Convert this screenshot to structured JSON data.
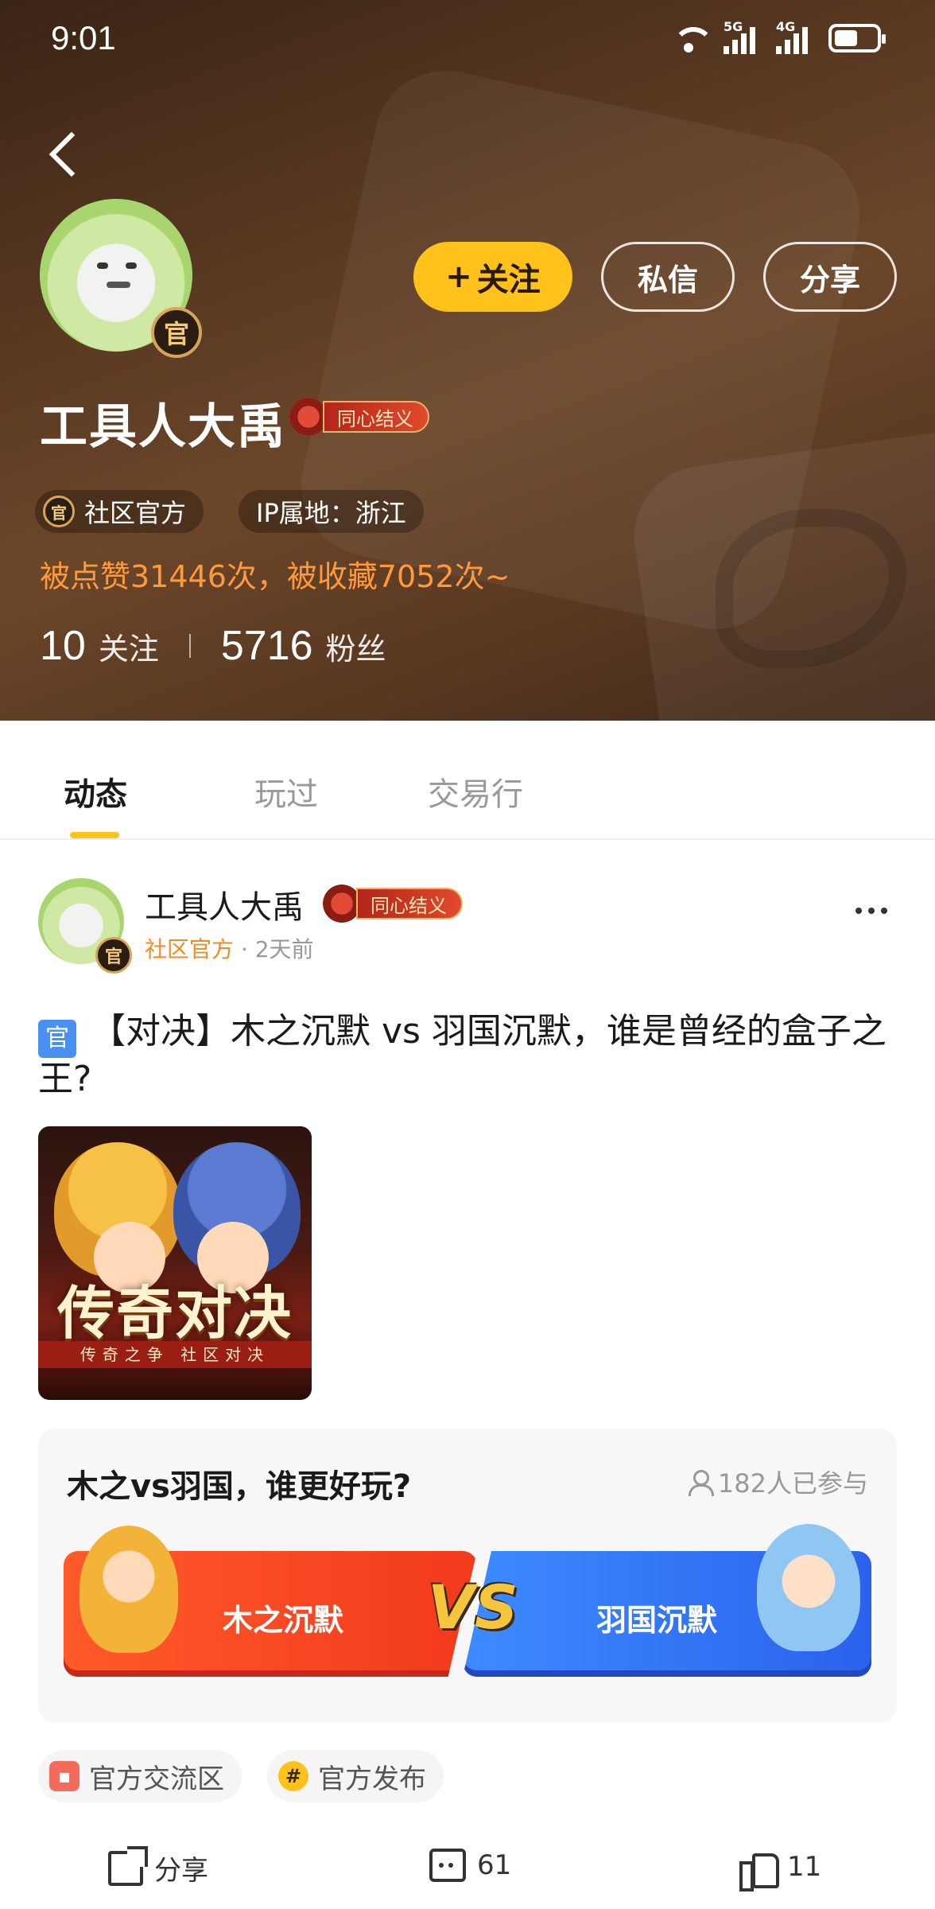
{
  "status_bar": {
    "time": "9:01",
    "signal_5g": "5G",
    "signal_4g": "4G"
  },
  "profile": {
    "name": "工具人大禹",
    "medal_label": "同心结义",
    "badge_char": "官",
    "follow_label": "关注",
    "message_label": "私信",
    "share_label": "分享",
    "official_chip": "社区官方",
    "ip_chip": "IP属地：浙江",
    "likes_line": "被点赞31446次，被收藏7052次~",
    "following_count": "10",
    "following_label": "关注",
    "fans_count": "5716",
    "fans_label": "粉丝"
  },
  "tabs": [
    {
      "label": "动态",
      "active": true
    },
    {
      "label": "玩过",
      "active": false
    },
    {
      "label": "交易行",
      "active": false
    }
  ],
  "post": {
    "author": "工具人大禹",
    "medal_label": "同心结义",
    "badge_char": "官",
    "official_label": "社区官方",
    "time_ago": "· 2天前",
    "title_tag": "官",
    "title": "【对决】木之沉默 vs 羽国沉默，谁是曾经的盒子之王?",
    "image_headline": "传奇对决",
    "image_band": "传奇之争 社区对决",
    "vote": {
      "question": "木之vs羽国，谁更好玩?",
      "participants": "182人已参与",
      "left_option": "木之沉默",
      "right_option": "羽国沉默",
      "vs_label": "VS"
    },
    "topics": [
      "官方交流区",
      "官方发布"
    ],
    "topic_icon_2": "#",
    "actions": {
      "share_label": "分享",
      "comment_count": "61",
      "like_count": "11"
    }
  },
  "colors": {
    "accent_yellow": "#ffc21b",
    "orange_text": "#ff9a3c",
    "vote_red": "#f23a1c",
    "vote_blue": "#2a62ec"
  }
}
